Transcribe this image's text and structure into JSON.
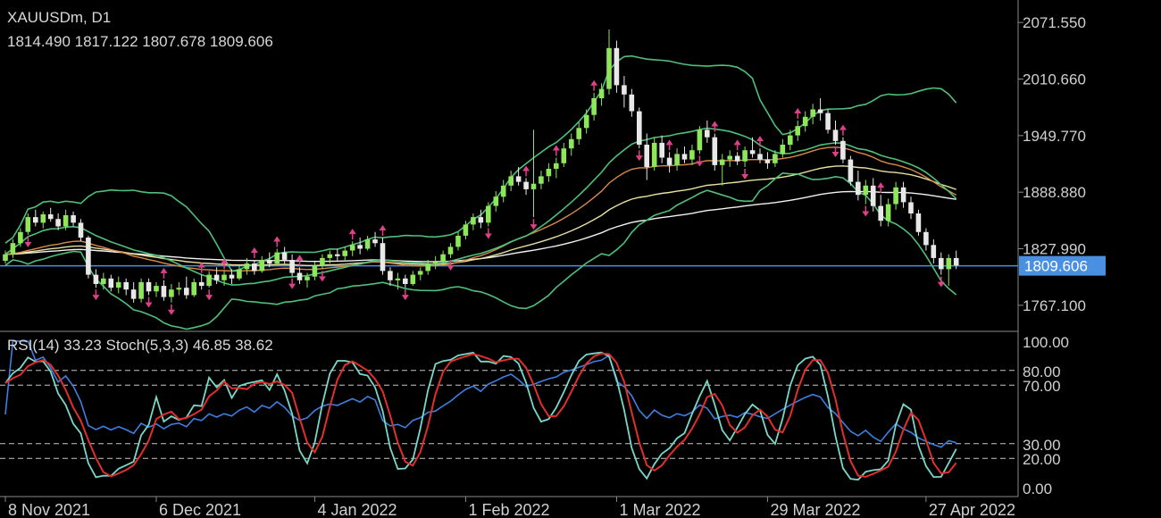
{
  "header": {
    "symbol": "XAUUSDm, D1",
    "ohlc": "1814.490 1817.122 1807.678 1809.606",
    "indicators": "RSI(14) 33.23 Stoch(5,3,3) 46.85 38.62"
  },
  "colors": {
    "background": "#000000",
    "bull": "#8ee65a",
    "bear": "#e8e8e8",
    "bollinger": "#4fbf7a",
    "ma_orange": "#d98a4a",
    "ma_yellow": "#e8e0a0",
    "ma_white": "#f2f2f2",
    "price_line": "#4a90e2",
    "arrow": "#e0408a",
    "rsi": "#3f7fe0",
    "stoch_main": "#7ad8c8",
    "stoch_signal": "#e0302a"
  },
  "chart_data": {
    "type": "candlestick",
    "current_price": "1809.606",
    "price_axis": {
      "ticks": [
        "2071.550",
        "2010.660",
        "1949.770",
        "1888.880",
        "1827.990",
        "1767.100"
      ],
      "ylim": [
        1740,
        2090
      ]
    },
    "oscillator_axis": {
      "ticks": [
        "100.00",
        "80.00",
        "70.00",
        "30.00",
        "20.00",
        "0.00"
      ],
      "levels": [
        80,
        70,
        30,
        20
      ],
      "ylim": [
        0,
        100
      ]
    },
    "x_axis": {
      "ticks": [
        {
          "label": "8 Nov 2021",
          "bar": 0
        },
        {
          "label": "6 Dec 2021",
          "bar": 20
        },
        {
          "label": "4 Jan 2022",
          "bar": 41
        },
        {
          "label": "1 Feb 2022",
          "bar": 61
        },
        {
          "label": "1 Mar 2022",
          "bar": 81
        },
        {
          "label": "29 Mar 2022",
          "bar": 101
        },
        {
          "label": "27 Apr 2022",
          "bar": 122
        }
      ]
    },
    "candles": [
      [
        1815,
        1826,
        1812,
        1822
      ],
      [
        1822,
        1838,
        1818,
        1834
      ],
      [
        1834,
        1850,
        1830,
        1846
      ],
      [
        1846,
        1866,
        1843,
        1862
      ],
      [
        1862,
        1870,
        1852,
        1856
      ],
      [
        1856,
        1868,
        1850,
        1865
      ],
      [
        1865,
        1872,
        1857,
        1860
      ],
      [
        1860,
        1866,
        1848,
        1852
      ],
      [
        1852,
        1870,
        1848,
        1864
      ],
      [
        1864,
        1868,
        1852,
        1856
      ],
      [
        1856,
        1860,
        1836,
        1840
      ],
      [
        1840,
        1842,
        1796,
        1800
      ],
      [
        1800,
        1806,
        1786,
        1790
      ],
      [
        1790,
        1802,
        1784,
        1796
      ],
      [
        1796,
        1800,
        1782,
        1786
      ],
      [
        1786,
        1798,
        1780,
        1792
      ],
      [
        1792,
        1796,
        1778,
        1784
      ],
      [
        1784,
        1792,
        1770,
        1774
      ],
      [
        1774,
        1796,
        1770,
        1792
      ],
      [
        1792,
        1796,
        1778,
        1782
      ],
      [
        1782,
        1792,
        1776,
        1788
      ],
      [
        1788,
        1794,
        1772,
        1776
      ],
      [
        1776,
        1790,
        1770,
        1784
      ],
      [
        1784,
        1792,
        1778,
        1786
      ],
      [
        1786,
        1798,
        1774,
        1778
      ],
      [
        1778,
        1796,
        1776,
        1792
      ],
      [
        1792,
        1800,
        1784,
        1788
      ],
      [
        1788,
        1804,
        1786,
        1800
      ],
      [
        1800,
        1808,
        1790,
        1794
      ],
      [
        1794,
        1804,
        1788,
        1800
      ],
      [
        1800,
        1806,
        1790,
        1796
      ],
      [
        1796,
        1810,
        1794,
        1806
      ],
      [
        1806,
        1818,
        1800,
        1812
      ],
      [
        1812,
        1816,
        1800,
        1804
      ],
      [
        1804,
        1820,
        1802,
        1816
      ],
      [
        1816,
        1824,
        1808,
        1812
      ],
      [
        1812,
        1828,
        1810,
        1824
      ],
      [
        1824,
        1830,
        1812,
        1816
      ],
      [
        1816,
        1822,
        1798,
        1802
      ],
      [
        1802,
        1808,
        1790,
        1794
      ],
      [
        1794,
        1802,
        1786,
        1798
      ],
      [
        1798,
        1814,
        1794,
        1810
      ],
      [
        1810,
        1822,
        1806,
        1818
      ],
      [
        1818,
        1826,
        1812,
        1822
      ],
      [
        1822,
        1828,
        1814,
        1820
      ],
      [
        1820,
        1830,
        1814,
        1826
      ],
      [
        1826,
        1836,
        1820,
        1832
      ],
      [
        1832,
        1840,
        1822,
        1828
      ],
      [
        1828,
        1842,
        1826,
        1838
      ],
      [
        1838,
        1846,
        1830,
        1834
      ],
      [
        1834,
        1840,
        1800,
        1804
      ],
      [
        1804,
        1808,
        1788,
        1794
      ],
      [
        1794,
        1802,
        1784,
        1796
      ],
      [
        1796,
        1800,
        1786,
        1790
      ],
      [
        1790,
        1804,
        1788,
        1800
      ],
      [
        1800,
        1808,
        1794,
        1804
      ],
      [
        1804,
        1816,
        1800,
        1812
      ],
      [
        1812,
        1820,
        1806,
        1814
      ],
      [
        1814,
        1826,
        1810,
        1822
      ],
      [
        1822,
        1834,
        1818,
        1830
      ],
      [
        1830,
        1846,
        1826,
        1842
      ],
      [
        1842,
        1858,
        1838,
        1854
      ],
      [
        1854,
        1866,
        1848,
        1862
      ],
      [
        1862,
        1870,
        1850,
        1856
      ],
      [
        1856,
        1878,
        1852,
        1874
      ],
      [
        1874,
        1890,
        1868,
        1884
      ],
      [
        1884,
        1902,
        1878,
        1896
      ],
      [
        1896,
        1912,
        1890,
        1906
      ],
      [
        1906,
        1916,
        1896,
        1900
      ],
      [
        1900,
        1904,
        1886,
        1892
      ],
      [
        1892,
        1956,
        1862,
        1898
      ],
      [
        1898,
        1912,
        1892,
        1906
      ],
      [
        1906,
        1920,
        1900,
        1914
      ],
      [
        1914,
        1926,
        1904,
        1920
      ],
      [
        1920,
        1942,
        1916,
        1936
      ],
      [
        1936,
        1952,
        1928,
        1946
      ],
      [
        1946,
        1964,
        1940,
        1958
      ],
      [
        1958,
        1978,
        1952,
        1972
      ],
      [
        1972,
        1996,
        1966,
        1990
      ],
      [
        1990,
        2006,
        1982,
        2000
      ],
      [
        2000,
        2064,
        1994,
        2044
      ],
      [
        2044,
        2052,
        1996,
        2004
      ],
      [
        2004,
        2014,
        1980,
        1994
      ],
      [
        1994,
        2000,
        1970,
        1976
      ],
      [
        1976,
        1980,
        1936,
        1940
      ],
      [
        1940,
        1952,
        1902,
        1916
      ],
      [
        1916,
        1948,
        1912,
        1942
      ],
      [
        1942,
        1950,
        1920,
        1926
      ],
      [
        1926,
        1932,
        1910,
        1918
      ],
      [
        1918,
        1936,
        1912,
        1930
      ],
      [
        1930,
        1938,
        1920,
        1924
      ],
      [
        1924,
        1940,
        1918,
        1934
      ],
      [
        1934,
        1960,
        1930,
        1956
      ],
      [
        1956,
        1966,
        1942,
        1948
      ],
      [
        1948,
        1952,
        1912,
        1918
      ],
      [
        1918,
        1930,
        1896,
        1924
      ],
      [
        1924,
        1934,
        1916,
        1928
      ],
      [
        1928,
        1932,
        1918,
        1922
      ],
      [
        1922,
        1938,
        1916,
        1934
      ],
      [
        1934,
        1948,
        1926,
        1930
      ],
      [
        1930,
        1936,
        1920,
        1924
      ],
      [
        1924,
        1932,
        1914,
        1920
      ],
      [
        1920,
        1934,
        1916,
        1930
      ],
      [
        1930,
        1946,
        1926,
        1940
      ],
      [
        1940,
        1956,
        1934,
        1950
      ],
      [
        1950,
        1966,
        1944,
        1960
      ],
      [
        1960,
        1976,
        1954,
        1970
      ],
      [
        1970,
        1984,
        1962,
        1978
      ],
      [
        1978,
        1990,
        1966,
        1974
      ],
      [
        1974,
        1978,
        1952,
        1956
      ],
      [
        1956,
        1966,
        1940,
        1944
      ],
      [
        1944,
        1948,
        1920,
        1924
      ],
      [
        1924,
        1928,
        1896,
        1900
      ],
      [
        1900,
        1912,
        1880,
        1886
      ],
      [
        1886,
        1902,
        1876,
        1896
      ],
      [
        1896,
        1904,
        1868,
        1874
      ],
      [
        1874,
        1886,
        1852,
        1858
      ],
      [
        1858,
        1882,
        1852,
        1876
      ],
      [
        1876,
        1900,
        1870,
        1894
      ],
      [
        1894,
        1900,
        1872,
        1878
      ],
      [
        1878,
        1884,
        1860,
        1866
      ],
      [
        1866,
        1870,
        1842,
        1846
      ],
      [
        1846,
        1850,
        1826,
        1832
      ],
      [
        1832,
        1838,
        1812,
        1818
      ],
      [
        1818,
        1824,
        1800,
        1806
      ],
      [
        1806,
        1822,
        1788,
        1818
      ],
      [
        1818,
        1826,
        1806,
        1810
      ]
    ],
    "upper_arrows": [
      21,
      26,
      29,
      33,
      36,
      39,
      46,
      50,
      69,
      73,
      78,
      88,
      94,
      97,
      100,
      105,
      111,
      116
    ],
    "lower_arrows": [
      3,
      12,
      19,
      22,
      27,
      38,
      42,
      53,
      59,
      64,
      70,
      84,
      92,
      98,
      110,
      114,
      124
    ]
  }
}
